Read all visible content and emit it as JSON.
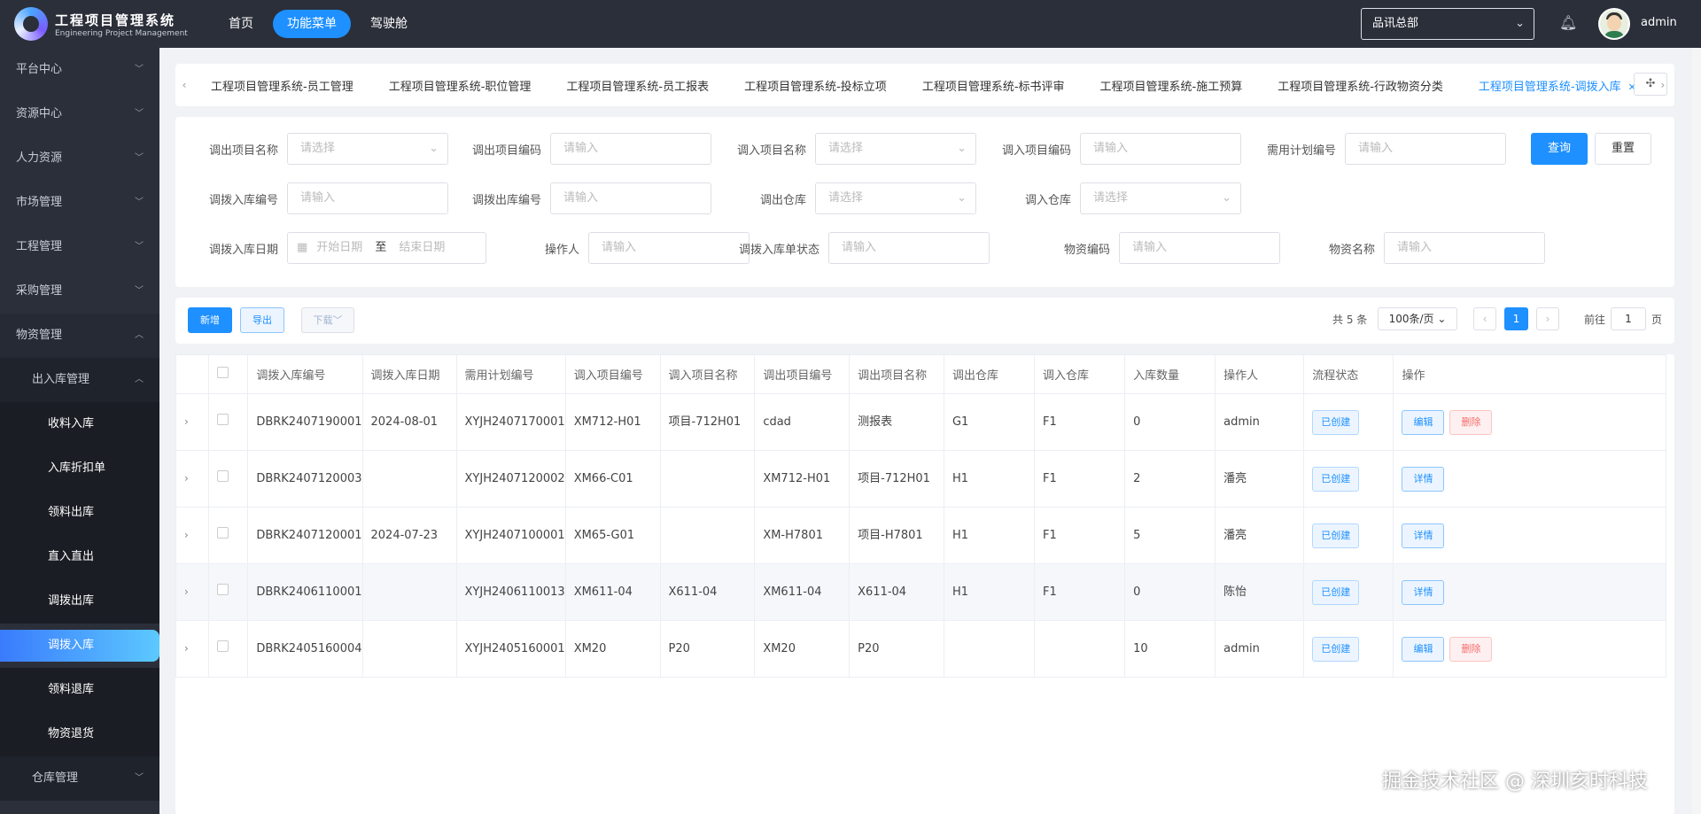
{
  "app": {
    "title": "工程项目管理系统",
    "subtitle": "Engineering Project Management"
  },
  "topnav": [
    {
      "label": "首页",
      "active": false
    },
    {
      "label": "功能菜单",
      "active": true
    },
    {
      "label": "驾驶舱",
      "active": false
    }
  ],
  "org_select": {
    "value": "品讯总部"
  },
  "user": {
    "name": "admin"
  },
  "sidebar": {
    "items": [
      {
        "label": "平台中心"
      },
      {
        "label": "资源中心"
      },
      {
        "label": "人力资源"
      },
      {
        "label": "市场管理"
      },
      {
        "label": "工程管理"
      },
      {
        "label": "采购管理"
      }
    ],
    "open_item": {
      "label": "物资管理"
    },
    "sub": {
      "label": "出入库管理"
    },
    "leaves": [
      "收料入库",
      "入库折扣单",
      "领料出库",
      "直入直出",
      "调拨出库",
      "调拨入库",
      "领料退库",
      "物资退货"
    ],
    "active_leaf": "调拨入库",
    "last_item": {
      "label": "仓库管理"
    }
  },
  "tabs": [
    {
      "label": "工程项目管理系统-员工管理"
    },
    {
      "label": "工程项目管理系统-职位管理"
    },
    {
      "label": "工程项目管理系统-员工报表"
    },
    {
      "label": "工程项目管理系统-投标立项"
    },
    {
      "label": "工程项目管理系统-标书评审"
    },
    {
      "label": "工程项目管理系统-施工预算"
    },
    {
      "label": "工程项目管理系统-行政物资分类"
    },
    {
      "label": "工程项目管理系统-调拨入库",
      "active": true
    }
  ],
  "filters": {
    "out_project_name": {
      "label": "调出项目名称",
      "placeholder": "请选择"
    },
    "out_project_code": {
      "label": "调出项目编码",
      "placeholder": "请输入"
    },
    "in_project_name": {
      "label": "调入项目名称",
      "placeholder": "请选择"
    },
    "in_project_code": {
      "label": "调入项目编码",
      "placeholder": "请输入"
    },
    "plan_code": {
      "label": "需用计划编号",
      "placeholder": "请输入"
    },
    "in_code": {
      "label": "调拨入库编号",
      "placeholder": "请输入"
    },
    "out_code": {
      "label": "调拨出库编号",
      "placeholder": "请输入"
    },
    "out_warehouse": {
      "label": "调出仓库",
      "placeholder": "请选择"
    },
    "in_warehouse": {
      "label": "调入仓库",
      "placeholder": "请选择"
    },
    "in_date": {
      "label": "调拨入库日期",
      "start": "开始日期",
      "sep": "至",
      "end": "结束日期"
    },
    "operator": {
      "label": "操作人",
      "placeholder": "请输入"
    },
    "status": {
      "label": "调拨入库单状态",
      "placeholder": "请输入"
    },
    "material_code": {
      "label": "物资编码",
      "placeholder": "请输入"
    },
    "material_name": {
      "label": "物资名称",
      "placeholder": "请输入"
    },
    "query_label": "查询",
    "reset_label": "重置"
  },
  "toolbar": {
    "add_label": "新增",
    "export_label": "导出",
    "download_label": "下载",
    "total": "共 5 条",
    "page_size": "100条/页",
    "page": "1",
    "goto_label": "前往",
    "goto_value": "1",
    "page_suffix": "页"
  },
  "table": {
    "headers": [
      "调拨入库编号",
      "调拨入库日期",
      "需用计划编号",
      "调入项目编号",
      "调入项目名称",
      "调出项目编号",
      "调出项目名称",
      "调出仓库",
      "调入仓库",
      "入库数量",
      "操作人",
      "流程状态",
      "操作"
    ],
    "rows": [
      {
        "code": "DBRK2407190001",
        "date": "2024-08-01",
        "plan": "XYJH2407170001",
        "in_no": "XM712-H01",
        "in_name": "项目-712H01",
        "out_no": "cdad",
        "out_name": "测报表",
        "out_wh": "G1",
        "in_wh": "F1",
        "qty": "0",
        "op": "admin",
        "status": "已创建",
        "actions": [
          "编辑",
          "删除"
        ]
      },
      {
        "code": "DBRK2407120003",
        "date": "",
        "plan": "XYJH2407120002",
        "in_no": "XM66-C01",
        "in_name": "",
        "out_no": "XM712-H01",
        "out_name": "项目-712H01",
        "out_wh": "H1",
        "in_wh": "F1",
        "qty": "2",
        "op": "潘亮",
        "status": "已创建",
        "actions": [
          "详情"
        ]
      },
      {
        "code": "DBRK2407120001",
        "date": "2024-07-23",
        "plan": "XYJH2407100001",
        "in_no": "XM65-G01",
        "in_name": "",
        "out_no": "XM-H7801",
        "out_name": "项目-H7801",
        "out_wh": "H1",
        "in_wh": "F1",
        "qty": "5",
        "op": "潘亮",
        "status": "已创建",
        "actions": [
          "详情"
        ]
      },
      {
        "code": "DBRK2406110001",
        "date": "",
        "plan": "XYJH2406110013",
        "in_no": "XM611-04",
        "in_name": "X611-04",
        "out_no": "XM611-04",
        "out_name": "X611-04",
        "out_wh": "H1",
        "in_wh": "F1",
        "qty": "0",
        "op": "陈怡",
        "status": "已创建",
        "actions": [
          "详情"
        ]
      },
      {
        "code": "DBRK2405160004",
        "date": "",
        "plan": "XYJH2405160001",
        "in_no": "XM20",
        "in_name": "P20",
        "out_no": "XM20",
        "out_name": "P20",
        "out_wh": "",
        "in_wh": "",
        "qty": "10",
        "op": "admin",
        "status": "已创建",
        "actions": [
          "编辑",
          "删除"
        ]
      }
    ]
  },
  "watermark": "掘金技术社区 @ 深圳亥时科技",
  "colors": {
    "accent": "#1e90ff",
    "sidebar_bg": "#2b2f3a",
    "danger": "#f56c6c"
  }
}
